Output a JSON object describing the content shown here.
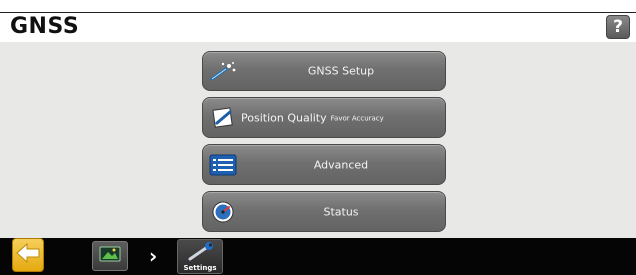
{
  "header": {
    "title": "GNSS",
    "help_label": "?"
  },
  "menu": {
    "items": [
      {
        "label": "GNSS Setup",
        "icon": "wand-icon"
      },
      {
        "label": "Position Quality",
        "sub": "Favor Accuracy",
        "icon": "note-icon"
      },
      {
        "label": "Advanced",
        "icon": "list-icon"
      },
      {
        "label": "Status",
        "icon": "gauge-icon"
      }
    ]
  },
  "footer": {
    "back_icon": "back-arrow-icon",
    "home_icon": "home-screen-icon",
    "separator": "›",
    "settings_label": "Settings",
    "settings_icon": "wrench-icon"
  },
  "colors": {
    "accent_yellow": "#f0c030",
    "button_gray": "#707070",
    "content_bg": "#e8e8e6",
    "bar_black": "#050505"
  }
}
